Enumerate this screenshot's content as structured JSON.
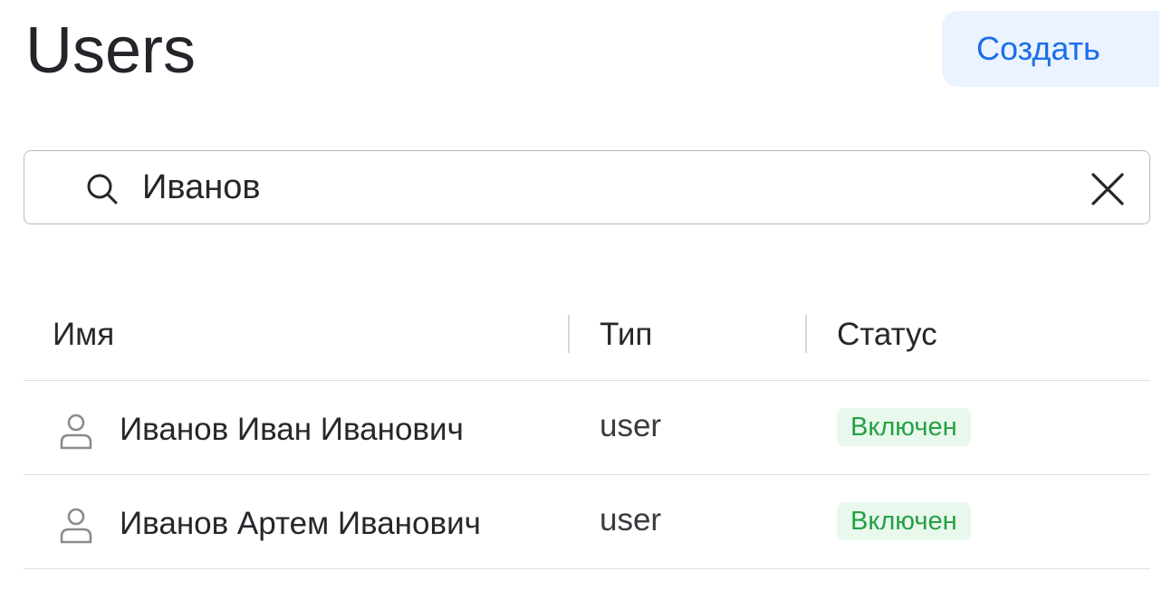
{
  "header": {
    "title": "Users",
    "create_label": "Создать"
  },
  "search": {
    "value": "Иванов",
    "icon": "search-icon",
    "clear_icon": "close-icon"
  },
  "table": {
    "columns": [
      "Имя",
      "Тип",
      "Статус"
    ],
    "rows": [
      {
        "icon": "user-icon",
        "name": "Иванов Иван Иванович",
        "type": "user",
        "status": "Включен"
      },
      {
        "icon": "user-icon",
        "name": "Иванов Артем Иванович",
        "type": "user",
        "status": "Включен"
      }
    ]
  },
  "colors": {
    "accent": "#1a6ee8",
    "accent_bg": "#eaf3ff",
    "status_enabled": "#23a143",
    "status_enabled_bg": "#e9f8ec"
  }
}
